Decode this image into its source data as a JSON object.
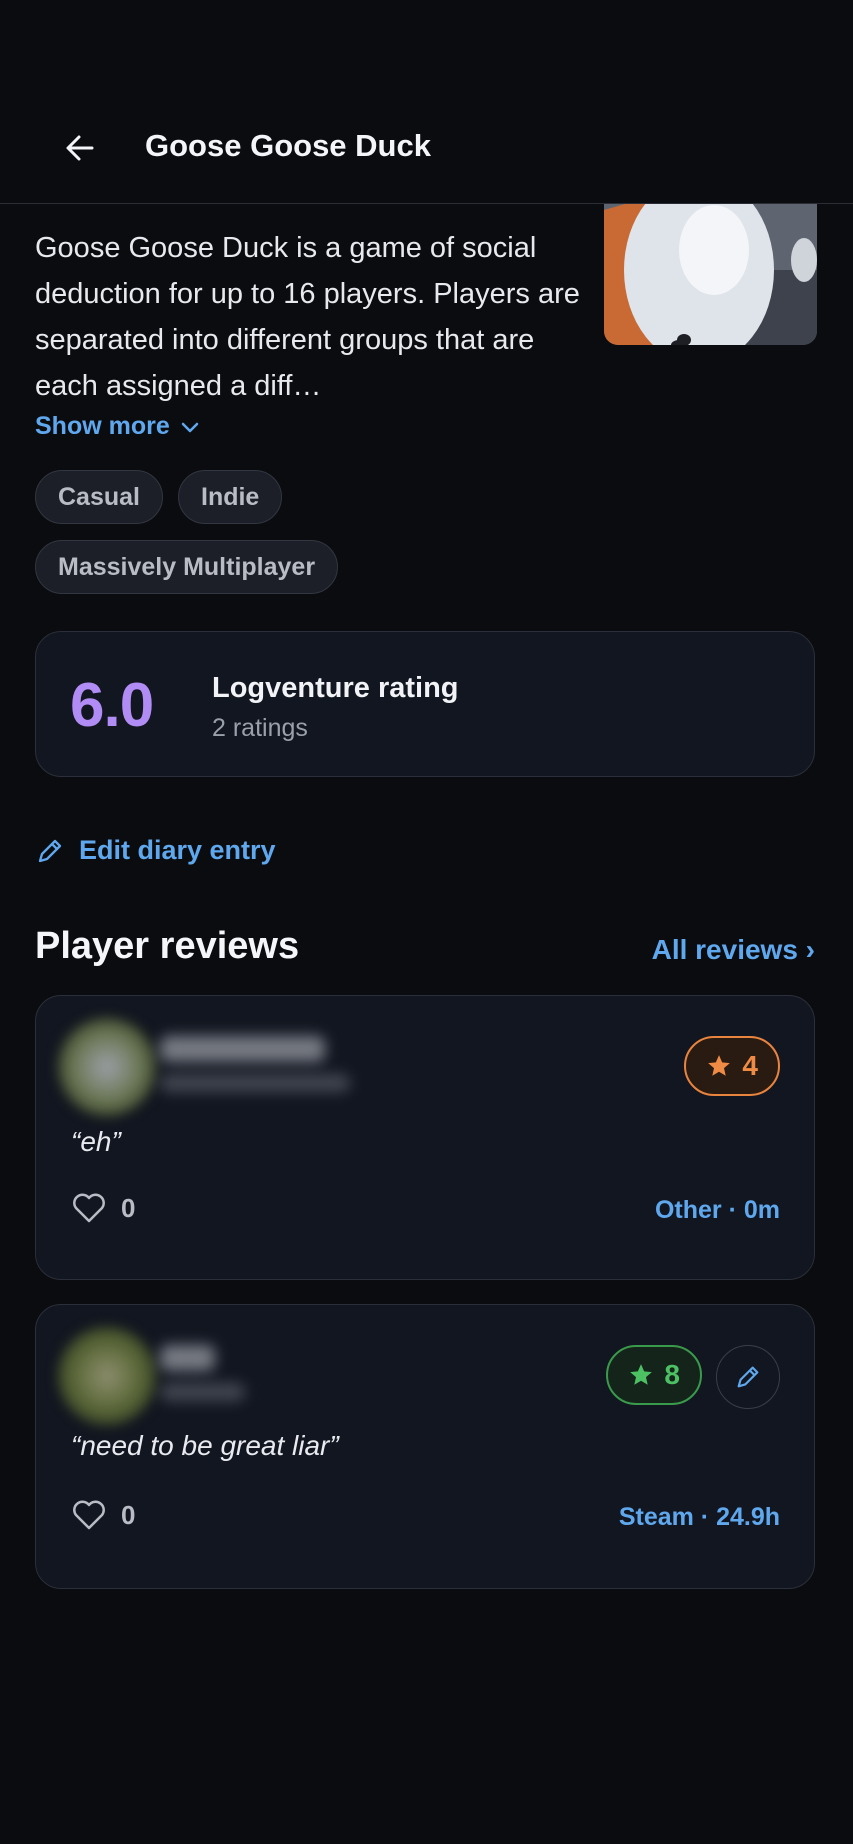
{
  "header": {
    "title": "Goose Goose Duck",
    "back_icon": "arrow-left-icon"
  },
  "game": {
    "description": "Goose Goose Duck is a game of social deduction for up to 16 players. Players are separated into different groups that are each assigned a diff…",
    "show_more": "Show more",
    "tags": [
      "Casual",
      "Indie",
      "Massively Multiplayer"
    ]
  },
  "rating": {
    "score": "6.0",
    "label": "Logventure rating",
    "count": "2 ratings",
    "score_color": "#b28cf5"
  },
  "diary": {
    "edit_label": "Edit diary entry"
  },
  "reviews_section": {
    "title": "Player reviews",
    "all_label": "All reviews ›"
  },
  "reviews": [
    {
      "quote": "“eh”",
      "rating": "4",
      "likes": "0",
      "source": "Other · 0m",
      "badge_color": "#f08b45"
    },
    {
      "quote": "“need to be great liar”",
      "rating": "8",
      "likes": "0",
      "source": "Steam · 24.9h",
      "badge_color": "#4cc063"
    }
  ],
  "colors": {
    "accent": "#5fa8ee",
    "background": "#0b0c10",
    "card": "#121620"
  }
}
